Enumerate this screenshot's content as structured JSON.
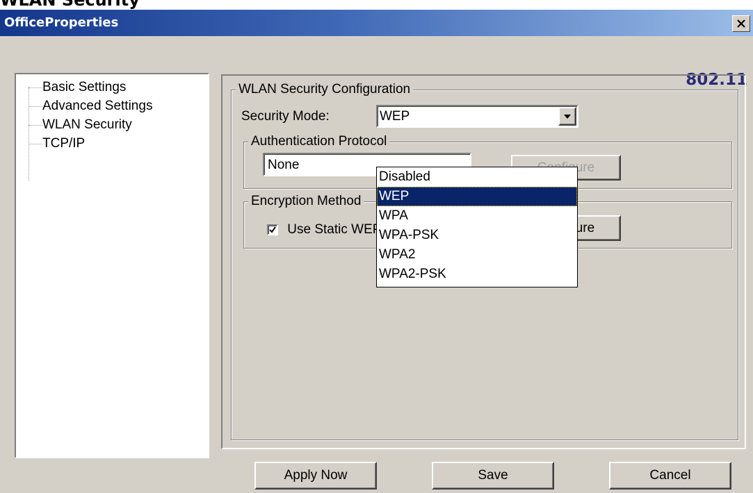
{
  "page_title_cropped": "WLAN Security",
  "window": {
    "title": "OfficeProperties",
    "close_icon": "close-icon"
  },
  "brand": "802.11",
  "tree": {
    "items": [
      {
        "label": "Basic Settings"
      },
      {
        "label": "Advanced Settings"
      },
      {
        "label": "WLAN Security"
      },
      {
        "label": "TCP/IP"
      }
    ]
  },
  "wlan_security": {
    "group_title": "WLAN Security Configuration",
    "security_mode_label": "Security Mode:",
    "security_mode_value": "WEP",
    "security_mode_options": [
      "Disabled",
      "WEP",
      "WPA",
      "WPA-PSK",
      "WPA2",
      "WPA2-PSK"
    ],
    "selected_option_index": 1,
    "authentication": {
      "group_title": "Authentication Protocol",
      "value": "None",
      "configure_button": "Configure"
    },
    "encryption": {
      "group_title": "Encryption Method",
      "checkbox_label": "Use Static WEP Keys",
      "checked": true,
      "configure_button": "Configure"
    }
  },
  "buttons": {
    "apply": "Apply Now",
    "save": "Save",
    "cancel": "Cancel"
  }
}
